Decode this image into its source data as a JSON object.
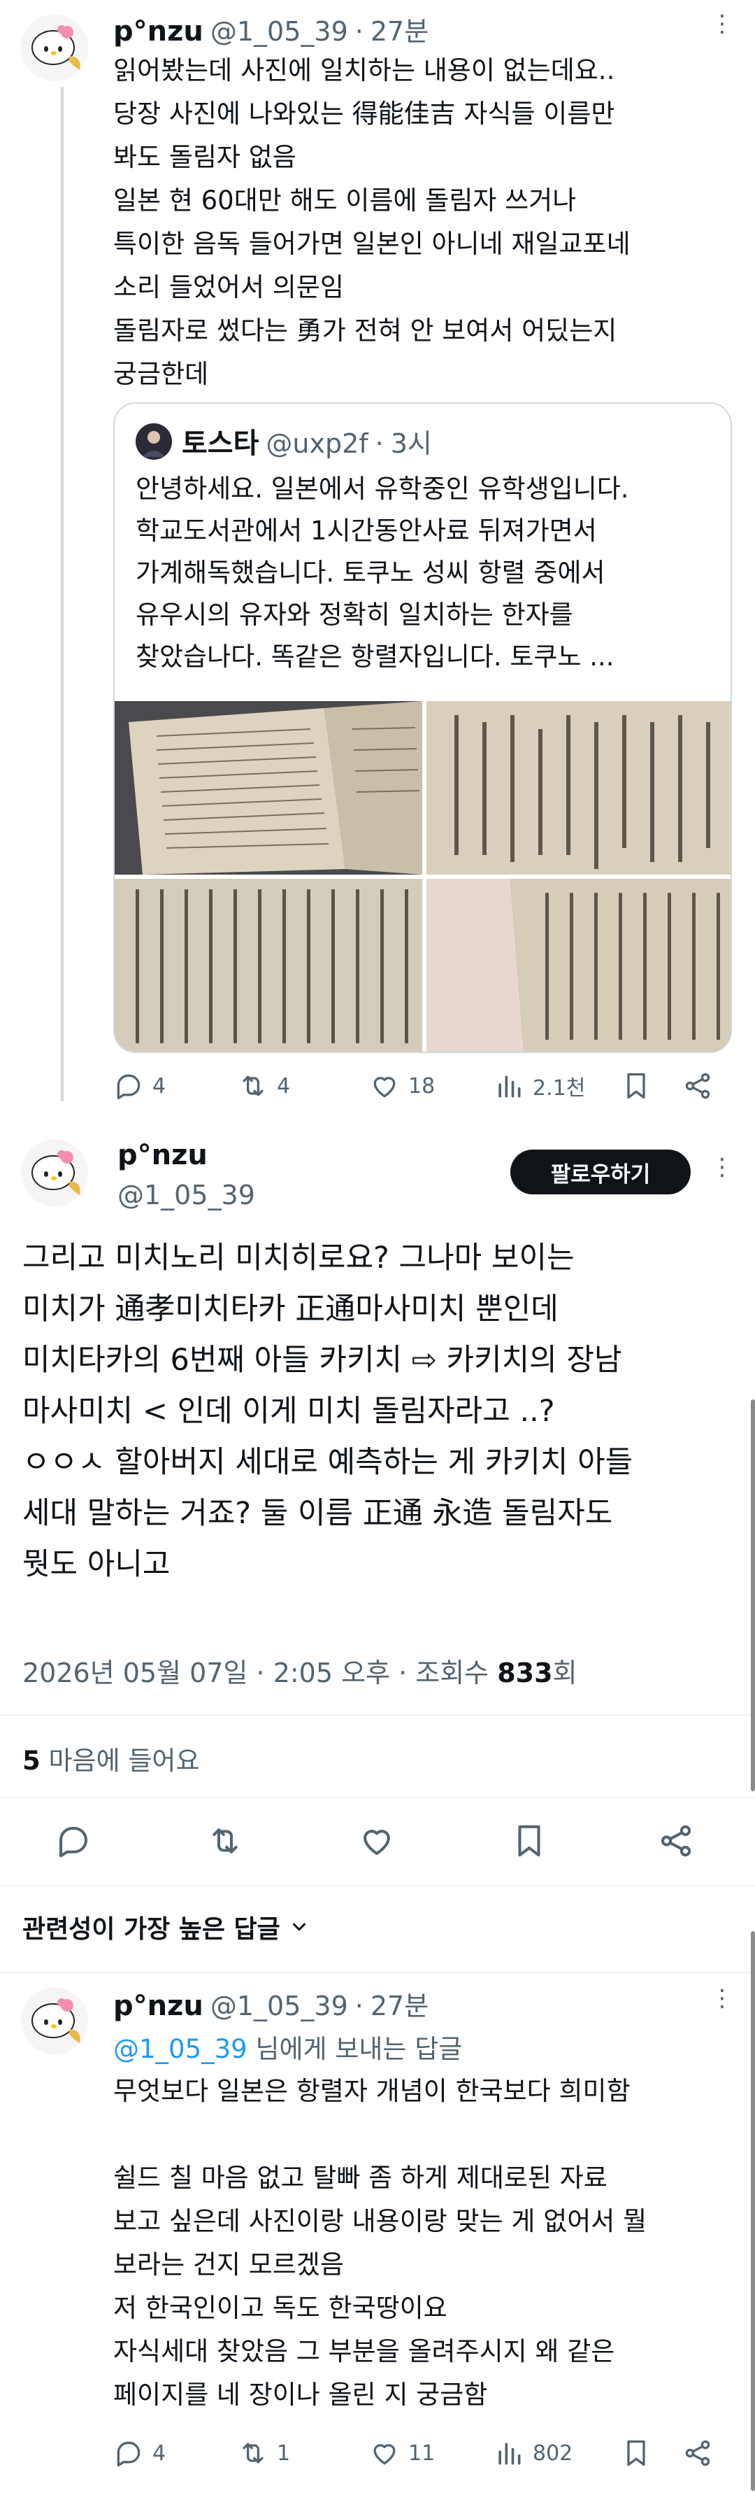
{
  "reply1": {
    "name": "p°nzu",
    "handle": "@1_05_39",
    "separator": "·",
    "time": "27분",
    "text": "읽어봤는데 사진에 일치하는 내용이 없는데요..\n당장 사진에 나와있는 得能佳吉 자식들 이름만\n봐도 돌림자 없음\n일본 현 60대만 해도 이름에 돌림자 쓰거나\n특이한 음독 들어가면 일본인 아니네 재일교포네\n소리 들었어서 의문임\n돌림자로 썼다는 勇가 전혀 안 보여서 어딨는지\n궁금한데"
  },
  "quote": {
    "name": "토스타",
    "handle": "@uxp2f",
    "separator": "·",
    "time": "3시",
    "text": "안녕하세요. 일본에서 유학중인 유학생입니다.\n학교도서관에서 1시간동안사료 뒤져가면서\n가계해독했습니다. 토쿠노 성씨 항렬 중에서\n유우시의 유자와 정확히 일치하는 한자를\n찾았습나다.  똑같은 항렬자입니다. 토쿠노 ..."
  },
  "reply1_actions": {
    "replies": "4",
    "reposts": "4",
    "likes": "18",
    "views": "2.1천"
  },
  "main": {
    "name": "p°nzu",
    "handle": "@1_05_39",
    "follow_label": "팔로우하기",
    "text": "그리고 미치노리 미치히로요? 그나마 보이는\n미치가 通孝미치타카 正通마사미치 뿐인데\n미치타카의 6번째 아들 카키치 ⇨ 카키치의 장남\n마사미치 < 인데 이게 미치 돌림자라고 ..?\nㅇㅇㅅ 할아버지 세대로 예측하는 게 카키치 아들\n세대 말하는 거죠? 둘 이름 正通 永造 돌림자도\n뭣도 아니고",
    "meta_date": "2026년 05월 07일 · 2:05 오후 · 조회수 ",
    "views": "833",
    "views_unit": "회",
    "likes_count": "5",
    "likes_label": " 마음에 들어요"
  },
  "sort": {
    "label": "관련성이 가장 높은 답글"
  },
  "reply2": {
    "name": "p°nzu",
    "handle": "@1_05_39",
    "separator": "·",
    "time": "27분",
    "mention": "@1_05_39",
    "mention_suffix": " 님에게 보내는 답글",
    "text": "무엇보다 일본은 항렬자 개념이 한국보다 희미함\n\n쉴드 칠 마음 없고 탈빠 좀 하게 제대로된 자료\n보고 싶은데 사진이랑 내용이랑 맞는 게 없어서 뭘\n보라는 건지 모르겠음\n저 한국인이고 독도 한국땅이요\n자식세대 찾았음 그 부분을 올려주시지 왜 같은\n페이지를 네 장이나 올린 지 궁금함",
    "replies": "4",
    "reposts": "1",
    "likes": "11",
    "views": "802"
  },
  "colors": {
    "accent": "#1d9bf0",
    "text": "#0f1419",
    "secondary": "#536471",
    "border": "#cfd9de"
  }
}
